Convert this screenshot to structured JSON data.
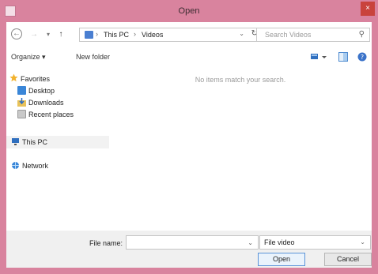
{
  "window": {
    "title": "Open",
    "close_glyph": "×"
  },
  "nav_buttons": {
    "back": "←",
    "forward": "→",
    "recent": "▾",
    "up": "↑"
  },
  "address": {
    "parts": [
      "This PC",
      "Videos"
    ],
    "separator": "›",
    "dropdown_glyph": "⌄",
    "refresh_glyph": "↻"
  },
  "search": {
    "placeholder": "Search Videos",
    "icon": "search-icon"
  },
  "toolbar": {
    "organize_label": "Organize ▾",
    "new_folder_label": "New folder"
  },
  "sidebar": {
    "favorites": "Favorites",
    "desktop": "Desktop",
    "downloads": "Downloads",
    "recent_places": "Recent places",
    "this_pc": "This PC",
    "network": "Network"
  },
  "content": {
    "empty_message": "No items match your search."
  },
  "bottom": {
    "file_name_label": "File name:",
    "file_name_value": "",
    "file_type_value": "File video",
    "open_label": "Open",
    "cancel_label": "Cancel"
  },
  "colors": {
    "title_bar": "#d9839e",
    "close_button": "#c9433c",
    "accent_blue": "#4a7fd1"
  }
}
